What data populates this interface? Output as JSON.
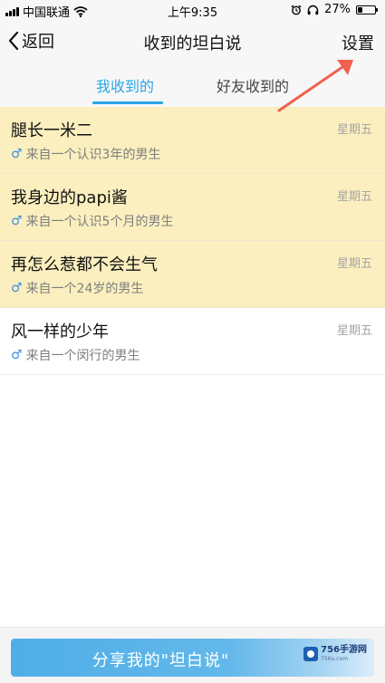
{
  "status_bar": {
    "carrier": "中国联通",
    "time": "上午9:35",
    "battery": "27%",
    "battery_level": 0.27
  },
  "nav": {
    "back_label": "返回",
    "title": "收到的坦白说",
    "settings_label": "设置"
  },
  "tabs": [
    {
      "label": "我收到的",
      "active": true
    },
    {
      "label": "好友收到的",
      "active": false
    }
  ],
  "messages": [
    {
      "title": "腿长一米二",
      "subtitle": "来自一个认识3年的男生",
      "day": "星期五",
      "unread": true
    },
    {
      "title": "我身边的papi酱",
      "subtitle": "来自一个认识5个月的男生",
      "day": "星期五",
      "unread": true
    },
    {
      "title": "再怎么惹都不会生气",
      "subtitle": "来自一个24岁的男生",
      "day": "星期五",
      "unread": true
    },
    {
      "title": "风一样的少年",
      "subtitle": "来自一个闵行的男生",
      "day": "星期五",
      "unread": false
    }
  ],
  "share": {
    "label": "分享我的\"坦白说\""
  },
  "watermark": {
    "name": "756手游网",
    "url": "756u.com"
  },
  "colors": {
    "accent": "#2aa6e6",
    "unread_bg": "#fbefbf",
    "arrow": "#f0614f"
  },
  "icons": {
    "gender": "male-icon",
    "back": "chevron-left-icon"
  }
}
